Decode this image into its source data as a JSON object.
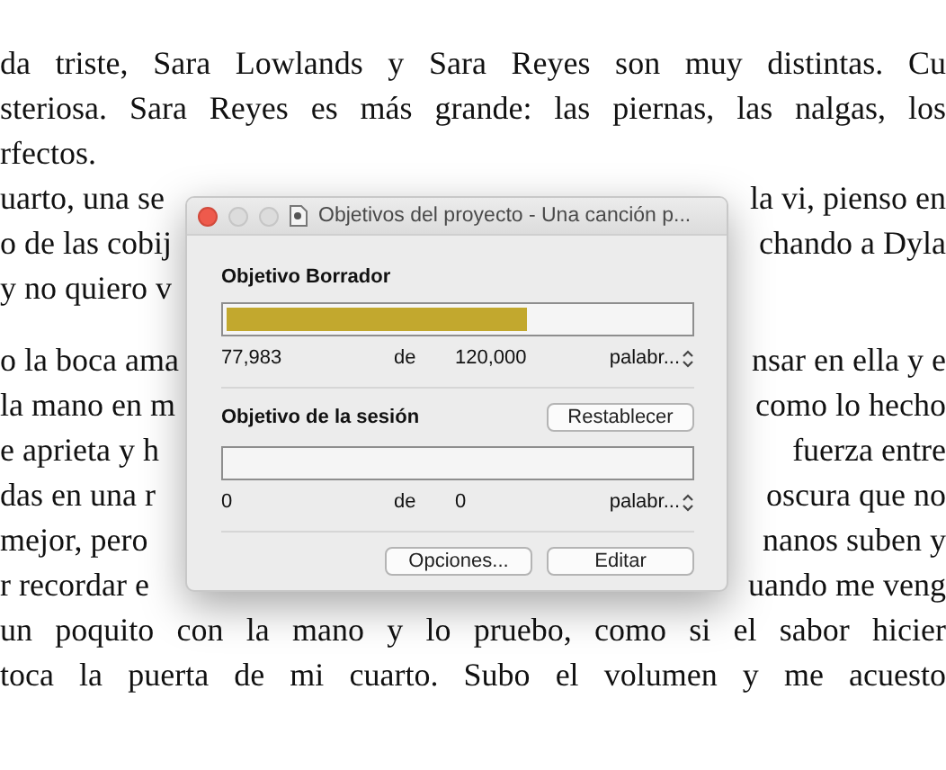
{
  "document": {
    "blocks": [
      {
        "lines": [
          {
            "kind": "full",
            "text": "da triste, Sara Lowlands y Sara Reyes son muy distintas. Cu"
          },
          {
            "kind": "full",
            "text": "steriosa. Sara Reyes es más grande: las piernas, las nalgas, los"
          },
          {
            "kind": "short",
            "text": "rfectos."
          },
          {
            "kind": "split",
            "left": "uarto, una se",
            "right": "la vi, pienso en"
          },
          {
            "kind": "split",
            "left": "o de las cobij",
            "right": "chando a Dyla"
          },
          {
            "kind": "split",
            "left": "y no quiero v"
          }
        ]
      },
      {
        "lines": [
          {
            "kind": "split",
            "left": "o la boca ama",
            "right": "nsar en ella y e"
          },
          {
            "kind": "split",
            "left": "la mano en m",
            "right": "como lo hecho"
          },
          {
            "kind": "split",
            "left": "e aprieta y h",
            "right": "fuerza entre"
          },
          {
            "kind": "split",
            "left": "das en una r",
            "right": "oscura que no"
          },
          {
            "kind": "split",
            "left": "mejor, pero",
            "right": "nanos suben y"
          },
          {
            "kind": "split",
            "left": "r recordar e",
            "right": "uando me veng"
          },
          {
            "kind": "full",
            "text": "un poquito con la mano y lo pruebo, como si el sabor hicier"
          },
          {
            "kind": "full",
            "text": "toca la puerta de mi cuarto. Subo el volumen y me acuesto"
          }
        ]
      }
    ]
  },
  "window": {
    "title": "Objetivos del proyecto - Una canción p...",
    "draft": {
      "label": "Objetivo Borrador",
      "level": 0.65,
      "count": "77,983",
      "of": "de",
      "target": "120,000",
      "unit": "palabr..."
    },
    "session": {
      "label": "Objetivo de la sesión",
      "reset": "Restablecer",
      "level": 0,
      "count": "0",
      "of": "de",
      "target": "0",
      "unit": "palabr..."
    },
    "buttons": [
      "Opciones...",
      "Editar"
    ]
  }
}
